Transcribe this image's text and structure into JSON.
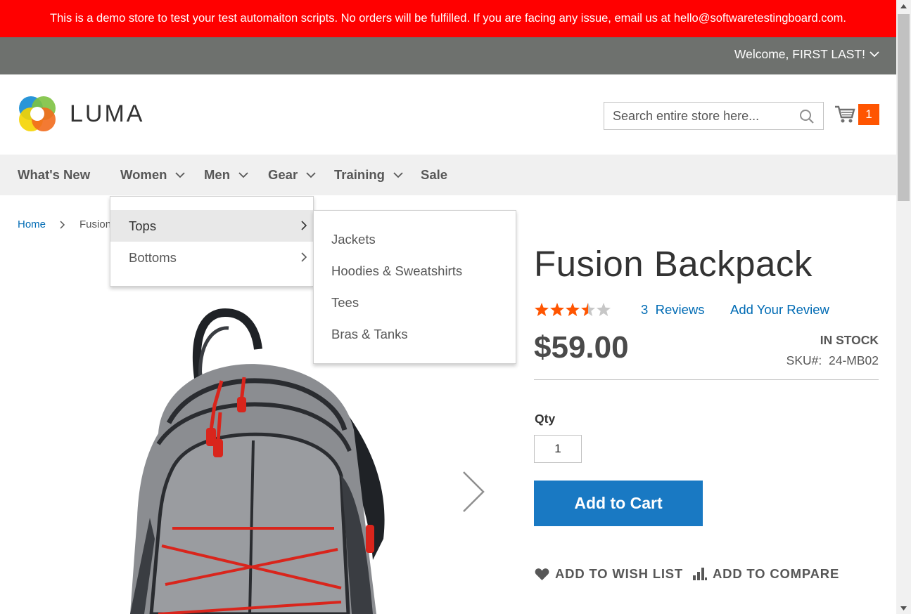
{
  "notice": "This is a demo store to test your test automaiton scripts. No orders will be fulfilled. If you are facing any issue, email us at hello@softwaretestingboard.com.",
  "header": {
    "welcome": "Welcome, FIRST LAST!",
    "logo_text": "LUMA",
    "search_placeholder": "Search entire store here...",
    "cart_count": "1"
  },
  "nav": {
    "whats_new": "What's New",
    "women": "Women",
    "men": "Men",
    "gear": "Gear",
    "training": "Training",
    "sale": "Sale"
  },
  "dropdown": {
    "tops": "Tops",
    "bottoms": "Bottoms"
  },
  "submenu": {
    "items": [
      "Jackets",
      "Hoodies & Sweatshirts",
      "Tees",
      "Bras & Tanks"
    ]
  },
  "breadcrumb": {
    "home": "Home",
    "current": "Fusion Backpack"
  },
  "product": {
    "title": "Fusion Backpack",
    "rating": 3.5,
    "rating_max": 5,
    "reviews_count": "3",
    "reviews_label": "Reviews",
    "add_review": "Add Your Review",
    "price": "$59.00",
    "stock": "IN STOCK",
    "sku_label": "SKU#:",
    "sku": "24-MB02",
    "qty_label": "Qty",
    "qty_value": "1",
    "add_to_cart": "Add to Cart",
    "wishlist": "ADD TO WISH LIST",
    "compare": "ADD TO COMPARE"
  },
  "colors": {
    "notice_bg": "#ff0000",
    "welcome_bg": "#6e716e",
    "accent_blue": "#1979c3",
    "link_blue": "#006bb4",
    "cart_badge": "#ff5501",
    "star": "#ff5501"
  }
}
